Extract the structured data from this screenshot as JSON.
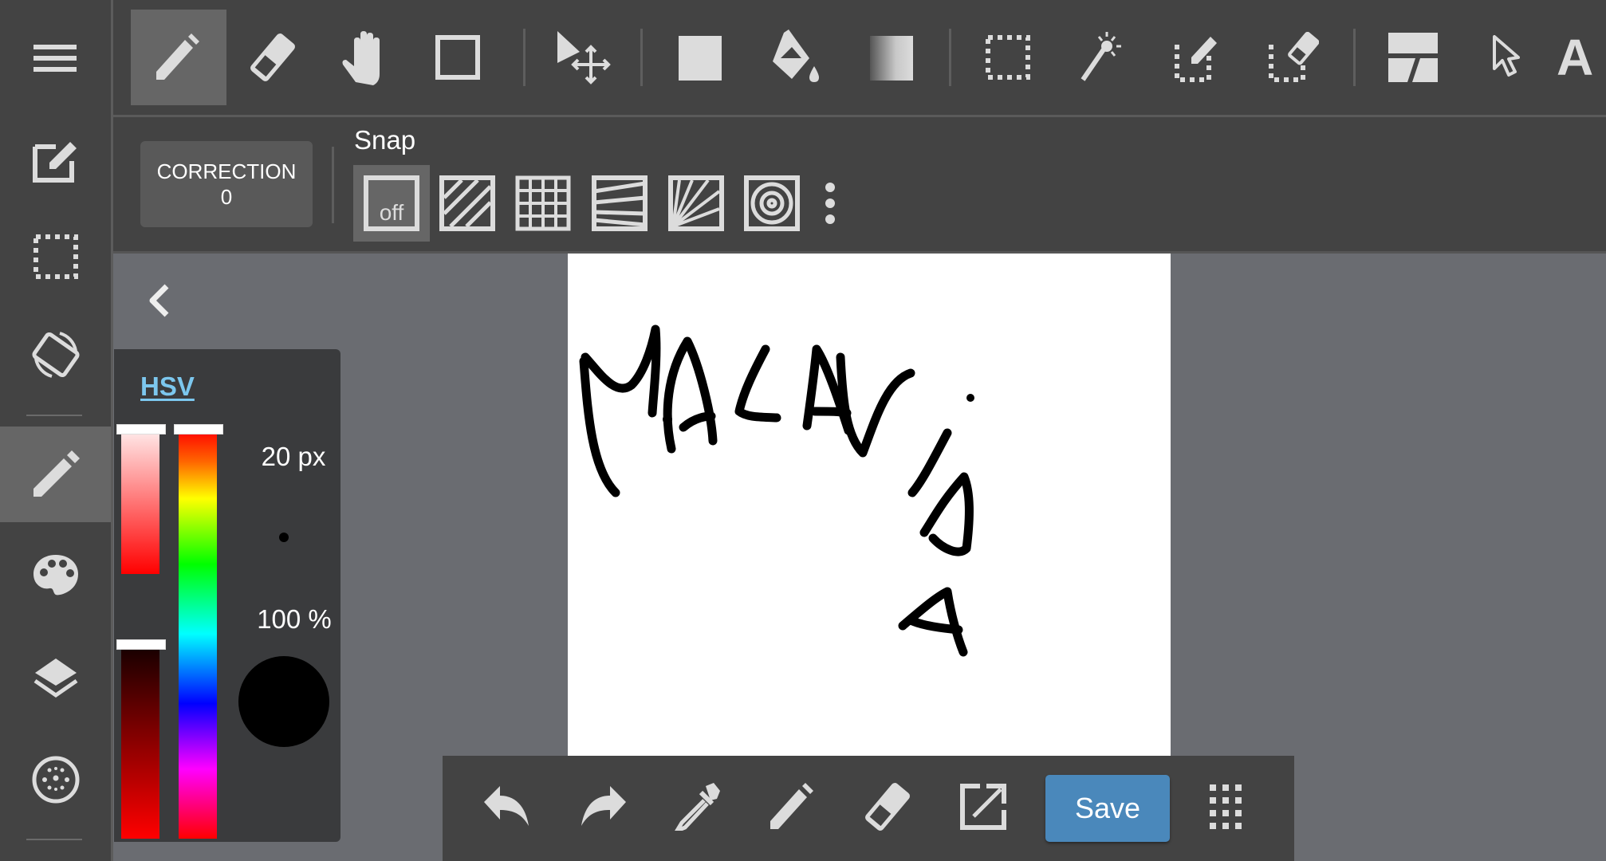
{
  "app": {
    "canvas_drawing_text": "MALAVIDA"
  },
  "sidebar": {
    "items": [
      {
        "name": "menu",
        "icon": "hamburger-menu-icon"
      },
      {
        "name": "edit",
        "icon": "edit-square-icon"
      },
      {
        "name": "selection",
        "icon": "dashed-selection-icon"
      },
      {
        "name": "rotate",
        "icon": "rotate-screen-icon"
      },
      {
        "name": "pen",
        "icon": "pencil-icon",
        "active": true
      },
      {
        "name": "color",
        "icon": "palette-icon"
      },
      {
        "name": "layers",
        "icon": "layers-icon"
      },
      {
        "name": "materials",
        "icon": "brush-dots-icon"
      }
    ]
  },
  "toolbar": {
    "tools": [
      {
        "name": "pen",
        "icon": "pencil-icon",
        "active": true
      },
      {
        "name": "eraser",
        "icon": "eraser-icon"
      },
      {
        "name": "hand",
        "icon": "hand-icon"
      },
      {
        "name": "shape",
        "icon": "rectangle-outline-icon"
      },
      {
        "name": "move",
        "icon": "move-arrows-icon"
      },
      {
        "name": "fill-rect",
        "icon": "filled-square-icon"
      },
      {
        "name": "bucket",
        "icon": "paint-bucket-icon"
      },
      {
        "name": "gradient",
        "icon": "gradient-icon"
      },
      {
        "name": "select",
        "icon": "dashed-selection-icon"
      },
      {
        "name": "magic-wand",
        "icon": "magic-wand-icon"
      },
      {
        "name": "select-pen",
        "icon": "selection-pen-icon"
      },
      {
        "name": "select-eraser",
        "icon": "selection-eraser-icon"
      },
      {
        "name": "frame",
        "icon": "frame-divide-icon"
      },
      {
        "name": "operation",
        "icon": "cursor-arrow-icon"
      },
      {
        "name": "text",
        "icon": "text-icon",
        "label": "A"
      }
    ]
  },
  "subbar": {
    "correction_label": "CORRECTION",
    "correction_value": "0",
    "snap_label": "Snap",
    "snap_off_label": "off",
    "snap_options": [
      "off",
      "parallel-lines",
      "grid",
      "perspective",
      "radial",
      "concentric"
    ],
    "snap_active": "off"
  },
  "colorpanel": {
    "mode_tab": "HSV",
    "brush_size": "20 px",
    "opacity": "100 %",
    "current_color": "#000000",
    "hue_fraction": 0.0,
    "saturation_fraction": 0.0,
    "value_fraction": 0.0
  },
  "bottombar": {
    "buttons": [
      {
        "name": "undo",
        "icon": "undo-icon"
      },
      {
        "name": "redo",
        "icon": "redo-icon"
      },
      {
        "name": "eyedropper",
        "icon": "eyedropper-icon"
      },
      {
        "name": "pen",
        "icon": "pencil-icon"
      },
      {
        "name": "eraser",
        "icon": "eraser-icon"
      },
      {
        "name": "export",
        "icon": "export-icon"
      }
    ],
    "save_label": "Save",
    "more_icon": "grid-dots-icon"
  },
  "colors": {
    "accent": "#4a88bb",
    "hsv_tab": "#7cc7ee",
    "panel": "#434343",
    "workspace": "#6a6c71"
  }
}
